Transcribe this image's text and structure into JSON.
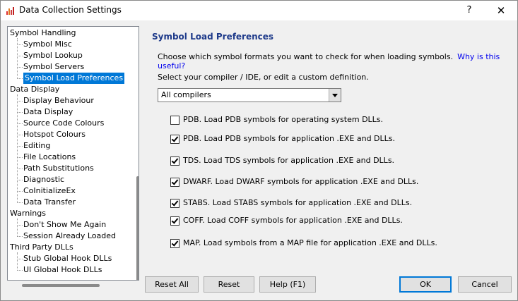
{
  "window": {
    "title": "Data Collection Settings",
    "help_glyph": "?",
    "close_glyph": "✕"
  },
  "tree": {
    "items": [
      {
        "label": "Symbol Handling",
        "level": 0
      },
      {
        "label": "Symbol Misc",
        "level": 1
      },
      {
        "label": "Symbol Lookup",
        "level": 1
      },
      {
        "label": "Symbol Servers",
        "level": 1
      },
      {
        "label": "Symbol Load Preferences",
        "level": 1,
        "selected": true
      },
      {
        "label": "Data Display",
        "level": 0
      },
      {
        "label": "Display Behaviour",
        "level": 1
      },
      {
        "label": "Data Display",
        "level": 1
      },
      {
        "label": "Source Code Colours",
        "level": 1
      },
      {
        "label": "Hotspot Colours",
        "level": 1
      },
      {
        "label": "Editing",
        "level": 1
      },
      {
        "label": "File Locations",
        "level": 1
      },
      {
        "label": "Path Substitutions",
        "level": 1
      },
      {
        "label": "Diagnostic",
        "level": 1
      },
      {
        "label": "CoInitializeEx",
        "level": 1
      },
      {
        "label": "Data Transfer",
        "level": 1
      },
      {
        "label": "Warnings",
        "level": 0
      },
      {
        "label": "Don't Show Me Again",
        "level": 1
      },
      {
        "label": "Session Already Loaded",
        "level": 1
      },
      {
        "label": "Third Party DLLs",
        "level": 0
      },
      {
        "label": "Stub Global Hook DLLs",
        "level": 1
      },
      {
        "label": "UI Global Hook DLLs",
        "level": 1
      }
    ]
  },
  "panel": {
    "title": "Symbol Load Preferences",
    "intro": "Choose which symbol formats you want to check for when loading symbols.",
    "why_link": "Why is this useful?",
    "select_label": "Select your compiler / IDE, or edit a custom definition.",
    "compiler_value": "All compilers",
    "options": [
      {
        "label": "PDB. Load PDB symbols for operating system DLLs.",
        "checked": false
      },
      {
        "label": "PDB. Load PDB symbols for application .EXE and DLLs.",
        "checked": true
      },
      {
        "label": "TDS. Load TDS symbols for application .EXE and DLLs.",
        "checked": true
      },
      {
        "label": "DWARF. Load DWARF symbols for application .EXE and DLLs.",
        "checked": true
      },
      {
        "label": "STABS. Load STABS symbols for application .EXE and DLLs.",
        "checked": true
      },
      {
        "label": "COFF. Load COFF symbols for application .EXE and DLLs.",
        "checked": true
      },
      {
        "label": "MAP. Load symbols from a MAP file for application .EXE and DLLs.",
        "checked": true
      }
    ]
  },
  "buttons": {
    "reset_all": "Reset All",
    "reset": "Reset",
    "help": "Help (F1)",
    "ok": "OK",
    "cancel": "Cancel"
  },
  "colors": {
    "selection": "#0078d7",
    "section_title": "#1e3a8a",
    "link": "#0000ee"
  },
  "icons": {
    "app": "bar-chart-icon"
  }
}
